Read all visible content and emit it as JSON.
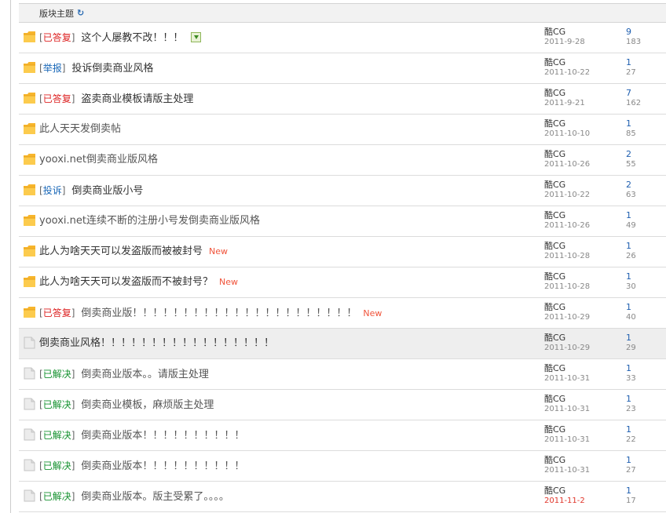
{
  "header": {
    "label": "版块主题",
    "refresh_icon": "↻"
  },
  "new_label": "New",
  "rows": [
    {
      "tag": "已答复",
      "tag_type": "answered",
      "title": "这个人屡教不改！！！",
      "title_color": "dark",
      "is_new": false,
      "has_attachment": true,
      "highlight": false,
      "icon": "folder",
      "author": "酷CG",
      "date": "2011-9-28",
      "date_red": false,
      "replies": "9",
      "views": "183"
    },
    {
      "tag": "举报",
      "tag_type": "report",
      "title": "投诉倒卖商业风格",
      "title_color": "dark",
      "is_new": false,
      "has_attachment": false,
      "highlight": false,
      "icon": "folder",
      "author": "酷CG",
      "date": "2011-10-22",
      "date_red": false,
      "replies": "1",
      "views": "27"
    },
    {
      "tag": "已答复",
      "tag_type": "answered",
      "title": "盗卖商业模板请版主处理",
      "title_color": "dark",
      "is_new": false,
      "has_attachment": false,
      "highlight": false,
      "icon": "folder",
      "author": "酷CG",
      "date": "2011-9-21",
      "date_red": false,
      "replies": "7",
      "views": "162"
    },
    {
      "tag": "",
      "tag_type": "",
      "title": "此人天天发倒卖帖",
      "title_color": "grey",
      "is_new": false,
      "has_attachment": false,
      "highlight": false,
      "icon": "folder",
      "author": "酷CG",
      "date": "2011-10-10",
      "date_red": false,
      "replies": "1",
      "views": "85"
    },
    {
      "tag": "",
      "tag_type": "",
      "title": "yooxi.net倒卖商业版风格",
      "title_color": "grey",
      "is_new": false,
      "has_attachment": false,
      "highlight": false,
      "icon": "folder",
      "author": "酷CG",
      "date": "2011-10-26",
      "date_red": false,
      "replies": "2",
      "views": "55"
    },
    {
      "tag": "投诉",
      "tag_type": "complaint",
      "title": "倒卖商业版小号",
      "title_color": "dark",
      "is_new": false,
      "has_attachment": false,
      "highlight": false,
      "icon": "folder",
      "author": "酷CG",
      "date": "2011-10-22",
      "date_red": false,
      "replies": "2",
      "views": "63"
    },
    {
      "tag": "",
      "tag_type": "",
      "title": "yooxi.net连续不断的注册小号发倒卖商业版风格",
      "title_color": "grey",
      "is_new": false,
      "has_attachment": false,
      "highlight": false,
      "icon": "folder",
      "author": "酷CG",
      "date": "2011-10-26",
      "date_red": false,
      "replies": "1",
      "views": "49"
    },
    {
      "tag": "",
      "tag_type": "",
      "title": "此人为啥天天可以发盗版而被被封号",
      "title_color": "dark",
      "is_new": true,
      "has_attachment": false,
      "highlight": false,
      "icon": "folder",
      "author": "酷CG",
      "date": "2011-10-28",
      "date_red": false,
      "replies": "1",
      "views": "26"
    },
    {
      "tag": "",
      "tag_type": "",
      "title": "此人为啥天天可以发盗版而不被封号？",
      "title_color": "dark",
      "is_new": true,
      "has_attachment": false,
      "highlight": false,
      "icon": "folder",
      "author": "酷CG",
      "date": "2011-10-28",
      "date_red": false,
      "replies": "1",
      "views": "30"
    },
    {
      "tag": "已答复",
      "tag_type": "answered",
      "title": "倒卖商业版！！！！！！！！！！！！！！！！！！！！！！",
      "title_color": "grey",
      "is_new": true,
      "has_attachment": false,
      "highlight": false,
      "icon": "folder",
      "author": "酷CG",
      "date": "2011-10-29",
      "date_red": false,
      "replies": "1",
      "views": "40"
    },
    {
      "tag": "",
      "tag_type": "",
      "title": "倒卖商业风格！！！！！！！！！！！！！！！！！",
      "title_color": "dark",
      "is_new": false,
      "has_attachment": false,
      "highlight": true,
      "icon": "doc",
      "author": "酷CG",
      "date": "2011-10-29",
      "date_red": false,
      "replies": "1",
      "views": "29"
    },
    {
      "tag": "已解决",
      "tag_type": "solved",
      "title": "倒卖商业版本。。请版主处理",
      "title_color": "grey",
      "is_new": false,
      "has_attachment": false,
      "highlight": false,
      "icon": "doc",
      "author": "酷CG",
      "date": "2011-10-31",
      "date_red": false,
      "replies": "1",
      "views": "33"
    },
    {
      "tag": "已解决",
      "tag_type": "solved",
      "title": "倒卖商业模板，麻烦版主处理",
      "title_color": "grey",
      "is_new": false,
      "has_attachment": false,
      "highlight": false,
      "icon": "doc",
      "author": "酷CG",
      "date": "2011-10-31",
      "date_red": false,
      "replies": "1",
      "views": "23"
    },
    {
      "tag": "已解决",
      "tag_type": "solved",
      "title": "倒卖商业版本！！！！！！！！！！",
      "title_color": "grey",
      "is_new": false,
      "has_attachment": false,
      "highlight": false,
      "icon": "doc",
      "author": "酷CG",
      "date": "2011-10-31",
      "date_red": false,
      "replies": "1",
      "views": "22"
    },
    {
      "tag": "已解决",
      "tag_type": "solved",
      "title": "倒卖商业版本！！！！！！！！！！",
      "title_color": "grey",
      "is_new": false,
      "has_attachment": false,
      "highlight": false,
      "icon": "doc",
      "author": "酷CG",
      "date": "2011-10-31",
      "date_red": false,
      "replies": "1",
      "views": "27"
    },
    {
      "tag": "已解决",
      "tag_type": "solved",
      "title": "倒卖商业版本。版主受累了。。。。",
      "title_color": "grey",
      "is_new": false,
      "has_attachment": false,
      "highlight": false,
      "icon": "doc",
      "author": "酷CG",
      "date": "2011-11-2",
      "date_red": true,
      "replies": "1",
      "views": "17"
    }
  ]
}
